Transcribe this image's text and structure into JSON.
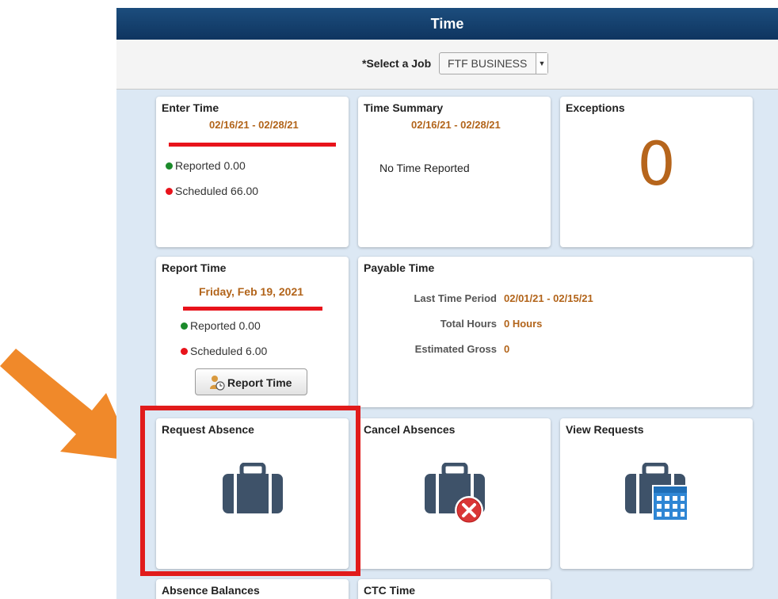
{
  "header": {
    "title": "Time"
  },
  "job_selector": {
    "label": "*Select a Job",
    "value": "FTF BUSINESS"
  },
  "tiles": {
    "enter_time": {
      "title": "Enter Time",
      "period": "02/16/21 - 02/28/21",
      "reported": "Reported 0.00",
      "scheduled": "Scheduled 66.00"
    },
    "time_summary": {
      "title": "Time Summary",
      "period": "02/16/21 - 02/28/21",
      "message": "No Time Reported"
    },
    "exceptions": {
      "title": "Exceptions",
      "count": "0"
    },
    "report_time": {
      "title": "Report Time",
      "date": "Friday, Feb 19, 2021",
      "reported": "Reported 0.00",
      "scheduled": "Scheduled 6.00",
      "button_label": "Report Time"
    },
    "payable_time": {
      "title": "Payable Time",
      "rows": [
        {
          "label": "Last Time Period",
          "value": "02/01/21 - 02/15/21"
        },
        {
          "label": "Total Hours",
          "value": "0 Hours"
        },
        {
          "label": "Estimated Gross",
          "value": "0"
        }
      ]
    },
    "request_absence": {
      "title": "Request Absence",
      "icon": "briefcase-icon"
    },
    "cancel_absences": {
      "title": "Cancel Absences",
      "icon": "briefcase-cancel-icon"
    },
    "view_requests": {
      "title": "View Requests",
      "icon": "briefcase-calendar-icon"
    },
    "absence_balances": {
      "title": "Absence Balances"
    },
    "ctc_time": {
      "title": "CTC Time"
    }
  },
  "colors": {
    "header_bg": "#173f6b",
    "accent_orange": "#b2641a",
    "status_green": "#1b8a2a",
    "status_red": "#e8131b",
    "highlight_red": "#e11b1b",
    "pointer_orange": "#f0892a",
    "icon_slate": "#3e5269",
    "calendar_blue": "#2f86d4"
  }
}
